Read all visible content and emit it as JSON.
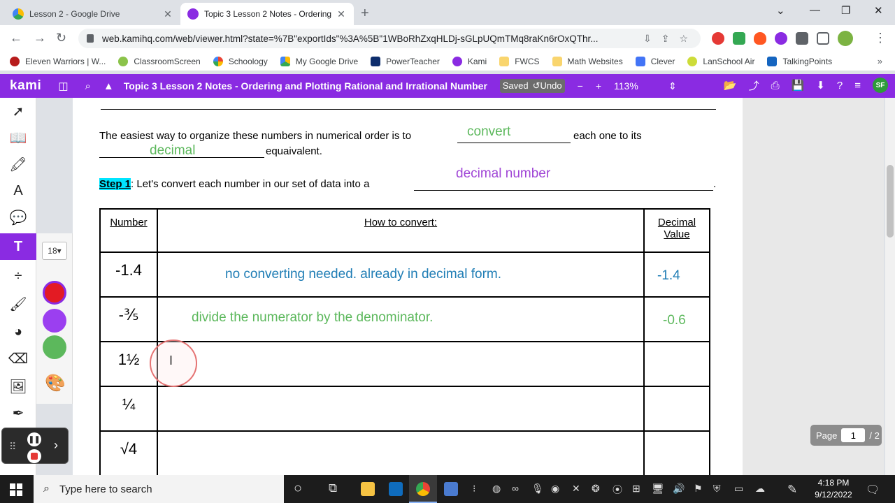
{
  "browser": {
    "tabs": [
      {
        "title": "Lesson 2 - Google Drive",
        "active": false
      },
      {
        "title": "Topic 3 Lesson 2 Notes - Ordering",
        "active": true
      }
    ],
    "new_tab": "+",
    "url": "web.kamihq.com/web/viewer.html?state=%7B\"exportIds\"%3A%5B\"1WBoRhZxqHLDj-sGLpUQmTMq8raKn6rOxQThr...",
    "bookmarks": [
      "Eleven Warriors | W...",
      "ClassroomScreen",
      "Schoology",
      "My Google Drive",
      "PowerTeacher",
      "Kami",
      "FWCS",
      "Math Websites",
      "Clever",
      "LanSchool Air",
      "TalkingPoints"
    ],
    "bookmarks_more": "»"
  },
  "kami": {
    "logo": "kami",
    "doc_title": "Topic 3 Lesson 2 Notes - Ordering and Plotting Rational and Irrational Numbers of",
    "saved": "Saved",
    "undo": "Undo",
    "zoom": "113%",
    "avatar": "SF",
    "font_size": "18",
    "colors": [
      "#e31b23",
      "#9b3ff0",
      "#5cb85c"
    ],
    "page_label": "Page",
    "page_current": "1",
    "page_total": "/ 2"
  },
  "document": {
    "sentence1_a": "The easiest way to organize these numbers in numerical order is to",
    "sentence1_b": "each one to its",
    "sentence1_c": "equaivalent.",
    "fill_convert": "convert",
    "fill_decimal": "decimal",
    "step_label": "Step 1",
    "step_text": ":  Let's convert each number in our set of data into a",
    "step_end": ".",
    "fill_decimal_number": "decimal number",
    "table": {
      "headers": {
        "number": "Number",
        "how": "How to convert:",
        "decimal_1": "Decimal",
        "decimal_2": "Value"
      },
      "rows": [
        {
          "number": "-1.4",
          "how": "no converting needed.  already in decimal form.",
          "value": "-1.4"
        },
        {
          "number": "-⅗",
          "how": "divide the numerator by the denominator.",
          "value": "-0.6"
        },
        {
          "number": "1½",
          "how": "",
          "value": ""
        },
        {
          "number": "¼",
          "how": "",
          "value": ""
        },
        {
          "number": "√4",
          "how": "",
          "value": ""
        }
      ]
    }
  },
  "taskbar": {
    "search_placeholder": "Type here to search",
    "time": "4:18 PM",
    "date": "9/12/2022"
  }
}
